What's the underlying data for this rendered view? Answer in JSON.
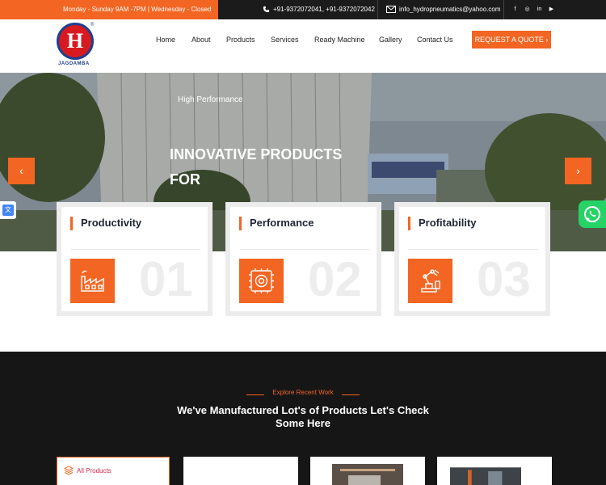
{
  "topbar": {
    "hours": "Monday - Sunday  9AM -7PM |  Wednesday - Closed",
    "phone": "+91-9372072041, +91-9372072042",
    "email": "info_hydropneumatics@yahoo.com",
    "social": [
      "f",
      "◎",
      "in",
      "▶"
    ]
  },
  "logo": {
    "word": "JAGDAMBA",
    "letter": "H",
    "reg": "®"
  },
  "nav": {
    "items": [
      "Home",
      "About",
      "Products",
      "Services",
      "Ready Machine",
      "Gallery",
      "Contact Us"
    ],
    "quote_label": "REQUEST A QUOTE  ›"
  },
  "hero": {
    "kicker": "High Performance",
    "headline": "INNOVATIVE PRODUCTS FOR",
    "prev_label": "‹",
    "next_label": "›"
  },
  "features": [
    {
      "title": "Productivity",
      "number": "01",
      "icon": "factory-icon"
    },
    {
      "title": "Performance",
      "number": "02",
      "icon": "gear-chip-icon"
    },
    {
      "title": "Profitability",
      "number": "03",
      "icon": "robot-arm-icon"
    }
  ],
  "recent": {
    "kicker": "Explore Recent Work",
    "heading": "We've Manufactured Lot's of Products Let's Check Some Here",
    "filter_label": "All Products"
  },
  "colors": {
    "accent": "#f26522",
    "dark": "#161616",
    "topbar": "#1b1b1b",
    "whatsapp": "#25d366"
  }
}
